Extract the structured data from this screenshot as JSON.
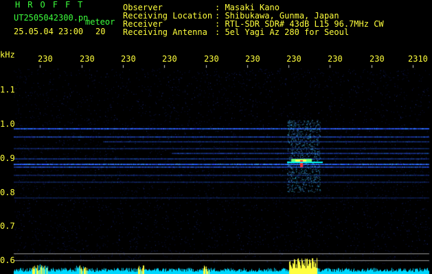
{
  "header": {
    "station_letters": [
      "H",
      "R",
      "O",
      "F",
      "F",
      "T"
    ],
    "filename": "UT2505042300.pn",
    "meteor_label": "meteor",
    "datetime": "25.05.04 23:00",
    "meteor_count": "20",
    "info": [
      {
        "label": "Observer",
        "value": ": Masaki Kano"
      },
      {
        "label": "Receiving Location",
        "value": ": Shibukawa, Gunma, Japan"
      },
      {
        "label": "Receiver",
        "value": ": RTL-SDR SDR# 43dB L15 96.7MHz CW"
      },
      {
        "label": "Receiving Antenna",
        "value": ": 5el Yagi Az 280 for Seoul"
      }
    ]
  },
  "axes": {
    "y_unit": "kHz",
    "y_ticks": [
      "1.1",
      "1.0",
      "0.9",
      "0.8",
      "0.7",
      "0.6"
    ],
    "x_ticks": [
      "230",
      "230",
      "230",
      "230",
      "230",
      "230",
      "230",
      "230",
      "230",
      "2310"
    ]
  },
  "colors": {
    "label_yellow": "#ffff3c",
    "label_green": "#3cff3c",
    "background": "#000000",
    "waterfall_blue": "#1e3cff",
    "bar_cyan": "#00e6ff"
  }
}
